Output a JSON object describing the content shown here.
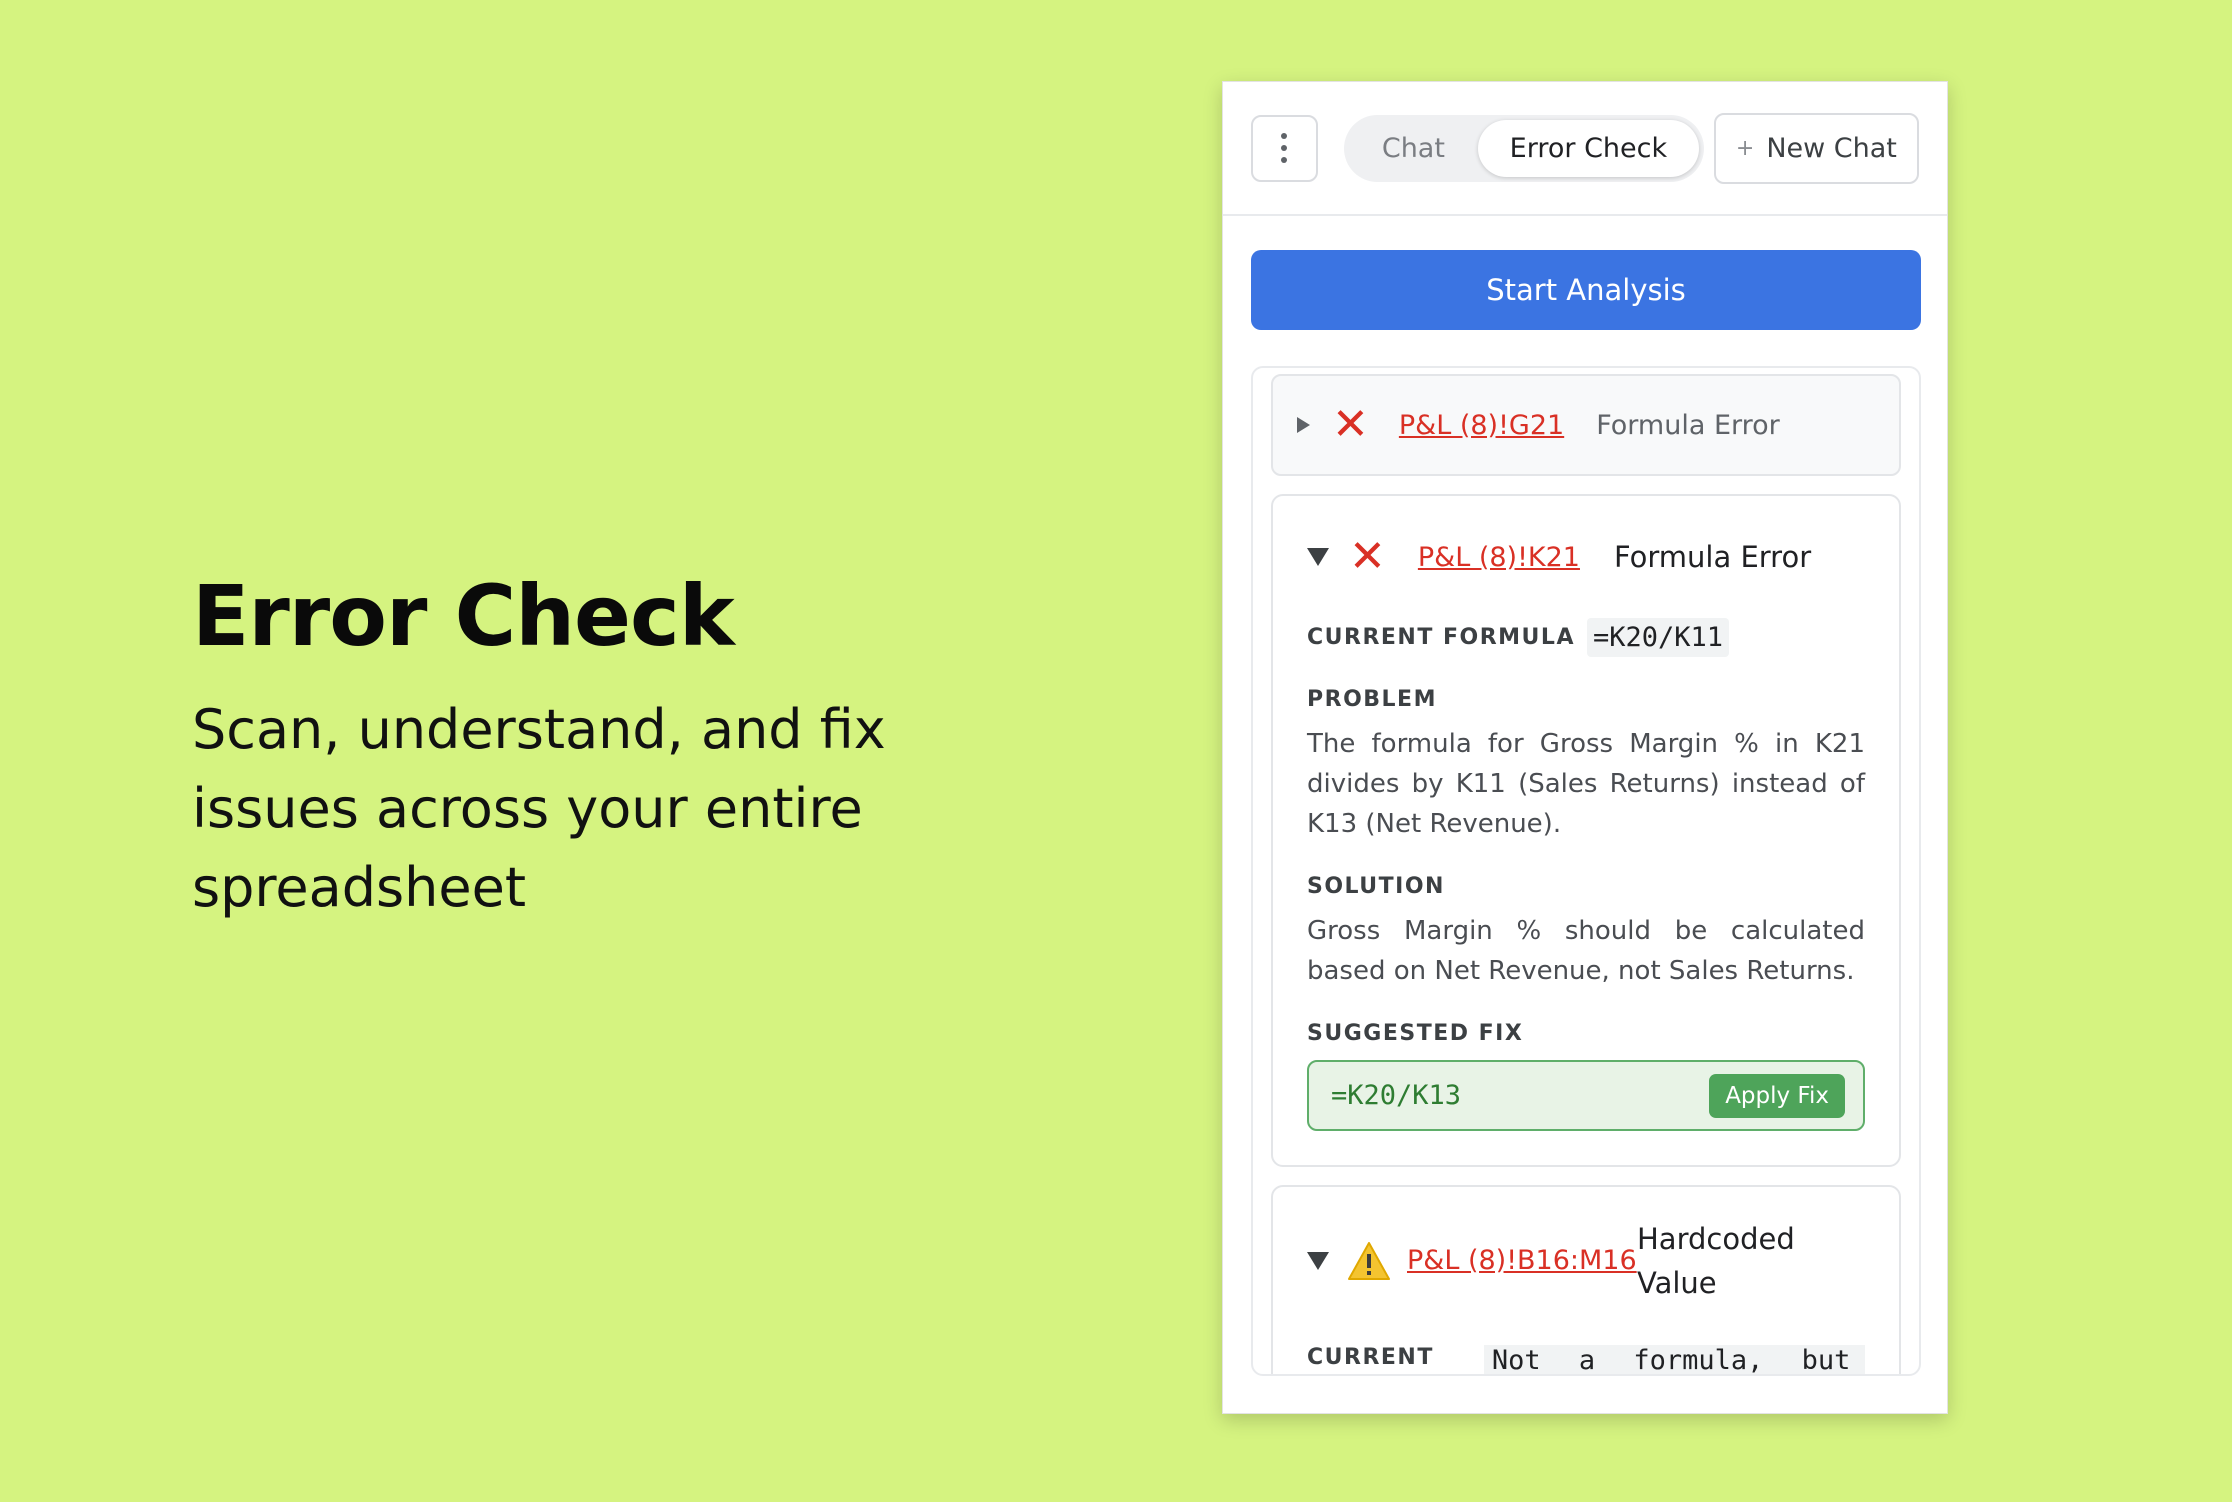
{
  "hero": {
    "title": "Error Check",
    "subtitle": "Scan, understand, and fix issues across your entire spreadsheet"
  },
  "topbar": {
    "tabs": [
      {
        "label": "Chat",
        "active": false
      },
      {
        "label": "Error Check",
        "active": true
      }
    ],
    "new_chat_icon": "+",
    "new_chat_label": "New Chat"
  },
  "start_button": "Start Analysis",
  "results": [
    {
      "expanded": false,
      "severity": "error",
      "icon": "close-icon",
      "cell": "P&L (8)!G21",
      "type": "Formula Error"
    },
    {
      "expanded": true,
      "severity": "error",
      "icon": "close-icon",
      "cell": "P&L (8)!K21",
      "type": "Formula Error",
      "current_formula_label": "CURRENT FORMULA",
      "current_formula": "=K20/K11",
      "problem_label": "PROBLEM",
      "problem": "The formula for Gross Margin % in K21 divides by K11 (Sales Returns) instead of K13 (Net Revenue).",
      "solution_label": "SOLUTION",
      "solution": "Gross Margin % should be calculated based on Net Revenue, not Sales Returns.",
      "suggested_fix_label": "SUGGESTED FIX",
      "suggested_fix": "=K20/K13",
      "apply_label": "Apply Fix"
    },
    {
      "expanded": true,
      "severity": "warning",
      "icon": "warning-icon",
      "cell": "P&L (8)!B16:M16",
      "type": "Hardcoded Value",
      "current_label": "CURRENT",
      "current_value": "Not a formula, but a"
    }
  ],
  "colors": {
    "background": "#d5f380",
    "primary": "#3b74e2",
    "error": "#d93025",
    "success": "#4ea45a",
    "warning": "#f4c430"
  }
}
